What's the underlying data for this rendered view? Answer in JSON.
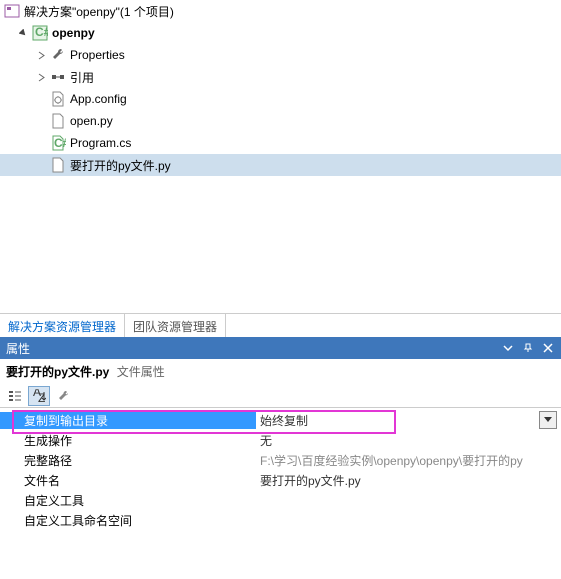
{
  "solution": {
    "label": "解决方案\"openpy\"(1 个项目)",
    "project": "openpy",
    "nodes": {
      "properties": "Properties",
      "references": "引用",
      "appconfig": "App.config",
      "openpy": "open.py",
      "programcs": "Program.cs",
      "targetpy": "要打开的py文件.py"
    }
  },
  "tabs": {
    "solution_explorer": "解决方案资源管理器",
    "team_explorer": "团队资源管理器"
  },
  "prop": {
    "title": "属性",
    "filename": "要打开的py文件.py",
    "filetype": "文件属性",
    "rows": {
      "copy_to_output": {
        "label": "复制到输出目录",
        "value": "始终复制"
      },
      "build_action": {
        "label": "生成操作",
        "value": "无"
      },
      "full_path": {
        "label": "完整路径",
        "value": "F:\\学习\\百度经验实例\\openpy\\openpy\\要打开的py"
      },
      "file_name": {
        "label": "文件名",
        "value": "要打开的py文件.py"
      },
      "custom_tool": {
        "label": "自定义工具",
        "value": ""
      },
      "custom_tool_ns": {
        "label": "自定义工具命名空间",
        "value": ""
      }
    }
  }
}
